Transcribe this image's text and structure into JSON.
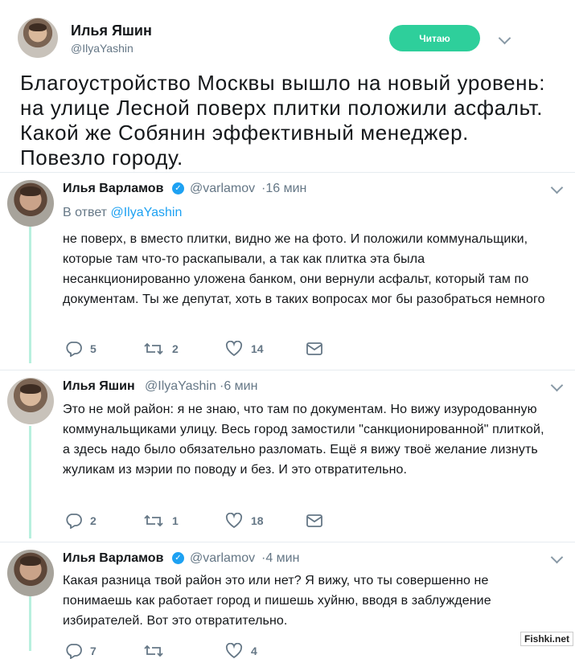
{
  "header": {
    "name": "Илья Яшин",
    "handle": "@IlyaYashin",
    "follow_label": "Читаю",
    "text": "Благоустройство Москвы вышло на новый уровень: на улице Лесной поверх плитки положили асфальт. Какой же Собянин эффективный менеджер. Повезло городу."
  },
  "replies": [
    {
      "name": "Илья Варламов",
      "verified": true,
      "handle": "@varlamov",
      "time": "·16 мин",
      "reply_to_label": "В ответ",
      "reply_to_handle": "@IlyaYashin",
      "text": "не поверх, в вместо плитки, видно же на фото. И положили коммунальщики, которые там что-то раскапывали, а так как плитка эта была несанкционированно уложена банком, они вернули асфальт, который там по документам. Ты же депутат, хоть в таких вопросах мог бы разобраться немного",
      "replies": "5",
      "retweets": "2",
      "likes": "14"
    },
    {
      "name": "Илья Яшин",
      "verified": false,
      "handle": "@IlyaYashin",
      "time": "·6 мин",
      "text": "Это не мой район: я не знаю, что там по документам. Но вижу изуродованную коммунальщиками улицу. Весь город замостили \"санкционированной\" плиткой, а здесь надо было обязательно разломать. Ещё я вижу твоё желание лизнуть жуликам из мэрии по поводу и без. И это отвратительно.",
      "replies": "2",
      "retweets": "1",
      "likes": "18"
    },
    {
      "name": "Илья Варламов",
      "verified": true,
      "handle": "@varlamov",
      "time": "·4 мин",
      "text": "Какая разница твой район это или нет? Я вижу, что ты совершенно не понимаешь как работает город и пишешь хуйню, вводя в заблуждение избирателей. Вот это отвратительно.",
      "replies": "7",
      "retweets": "",
      "likes": "4"
    }
  ],
  "watermark": "Fishki.net",
  "colors": {
    "follow": "#2ecf9b",
    "link": "#1da1f2",
    "thread": "#b8f0de",
    "muted": "#657786"
  }
}
